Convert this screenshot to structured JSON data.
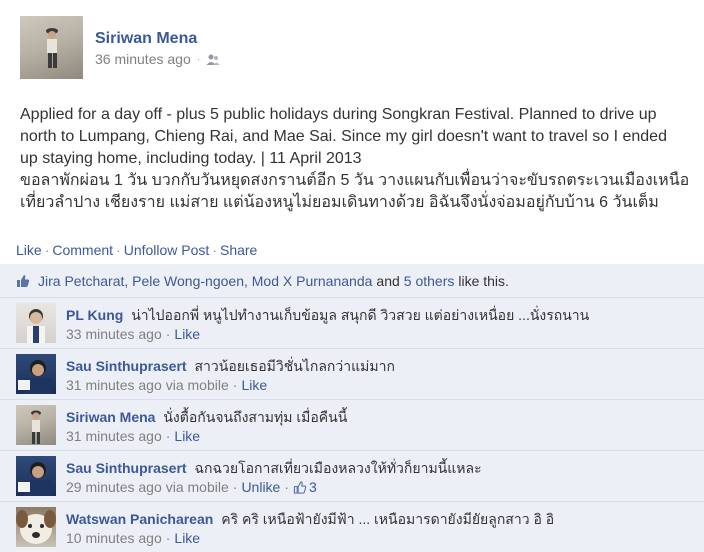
{
  "post": {
    "author": "Siriwan Mena",
    "time": "36 minutes ago",
    "audience_icon": "friends-icon",
    "text_en_line1": "Applied for a day off - plus 5 public holidays during Songkran Festival. Planned to drive up",
    "text_en_line2": "north to Lumpang, Chieng Rai, and Mae Sai. Since my girl doesn't want to travel so I ended",
    "text_en_line3": "up staying home, including today. | 11 April 2013",
    "text_th_line1": "ขอลาพักผ่อน 1 วัน บวกกับวันหยุดสงกรานต์อีก 5 วัน วางแผนกับเพื่อนว่าจะขับรถตระเวนเมืองเหนือ",
    "text_th_line2": "เที่ยวลำปาง เชียงราย แม่สาย แต่น้องหนูไม่ยอมเดินทางด้วย อิฉันจึงนั่งจ่อมอยู่กับบ้าน 6 วันเต็ม"
  },
  "actions": {
    "like": "Like",
    "comment": "Comment",
    "unfollow": "Unfollow Post",
    "share": "Share",
    "separator": "·"
  },
  "likes": {
    "icon": "thumbs-up-icon",
    "names": "Jira Petcharat, Pele Wong-ngoen, Mod X Purnananda",
    "and": "and",
    "others": "5 others",
    "suffix": "like this."
  },
  "comments": [
    {
      "name": "PL Kung",
      "text": "น่าไปออกพี่ หนูไปทำงานเก็บข้อมูล สนุกดี วิวสวย แต่อย่างเหนื่อย ...นั่งรถนาน",
      "time": "33 minutes ago",
      "via": "",
      "action": "Like",
      "likes": ""
    },
    {
      "name": "Sau Sinthuprasert",
      "text": "สาวน้อยเธอมีวิชั่นไกลกว่าแม่มาก",
      "time": "31 minutes ago",
      "via": "via mobile",
      "action": "Like",
      "likes": ""
    },
    {
      "name": "Siriwan Mena",
      "text": "นั่งตื้อกันจนถึงสามทุ่ม เมื่อคืนนี้",
      "time": "31 minutes ago",
      "via": "",
      "action": "Like",
      "likes": ""
    },
    {
      "name": "Sau Sinthuprasert",
      "text": "ฉกฉวยโอกาสเที่ยวเมืองหลวงให้ทั่วก็ยามนี้แหละ",
      "time": "29 minutes ago",
      "via": "via mobile",
      "action": "Unlike",
      "likes": "3"
    },
    {
      "name": "Watswan Panicharean",
      "text": "คริ คริ เหนือฟ้ายังมีฟ้า ... เหนือมารดายังมียัยลูกสาว อิ อิ",
      "time": "10 minutes ago",
      "via": "",
      "action": "Like",
      "likes": ""
    }
  ]
}
